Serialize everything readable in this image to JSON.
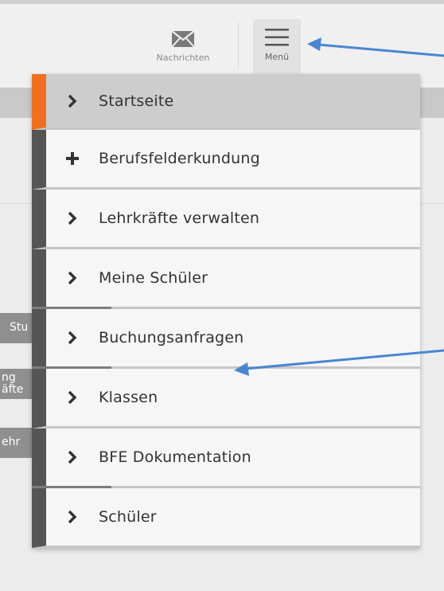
{
  "header": {
    "messages_label": "Nachrichten",
    "messages_icon": "envelope-icon",
    "menu_label": "Menü",
    "menu_icon": "hamburger-icon"
  },
  "side_tabs": [
    {
      "text": "Stu"
    },
    {
      "text": "ng",
      "text2": "äfte"
    },
    {
      "text": "ehr"
    }
  ],
  "menu": {
    "items": [
      {
        "label": "Startseite",
        "icon": "chevron-right-icon",
        "active": true
      },
      {
        "label": "Berufsfelderkundung",
        "icon": "plus-icon"
      },
      {
        "label": "Lehrkräfte verwalten",
        "icon": "chevron-right-icon"
      },
      {
        "label": "Meine Schüler",
        "icon": "chevron-right-icon"
      },
      {
        "label": "Buchungsanfragen",
        "icon": "chevron-right-icon"
      },
      {
        "label": "Klassen",
        "icon": "chevron-right-icon"
      },
      {
        "label": "BFE Dokumentation",
        "icon": "chevron-right-icon"
      },
      {
        "label": "Schüler",
        "icon": "chevron-right-icon"
      }
    ]
  },
  "colors": {
    "active_accent": "#f07020",
    "item_stripe": "#555555",
    "annotation_arrow": "#4a86d0"
  }
}
